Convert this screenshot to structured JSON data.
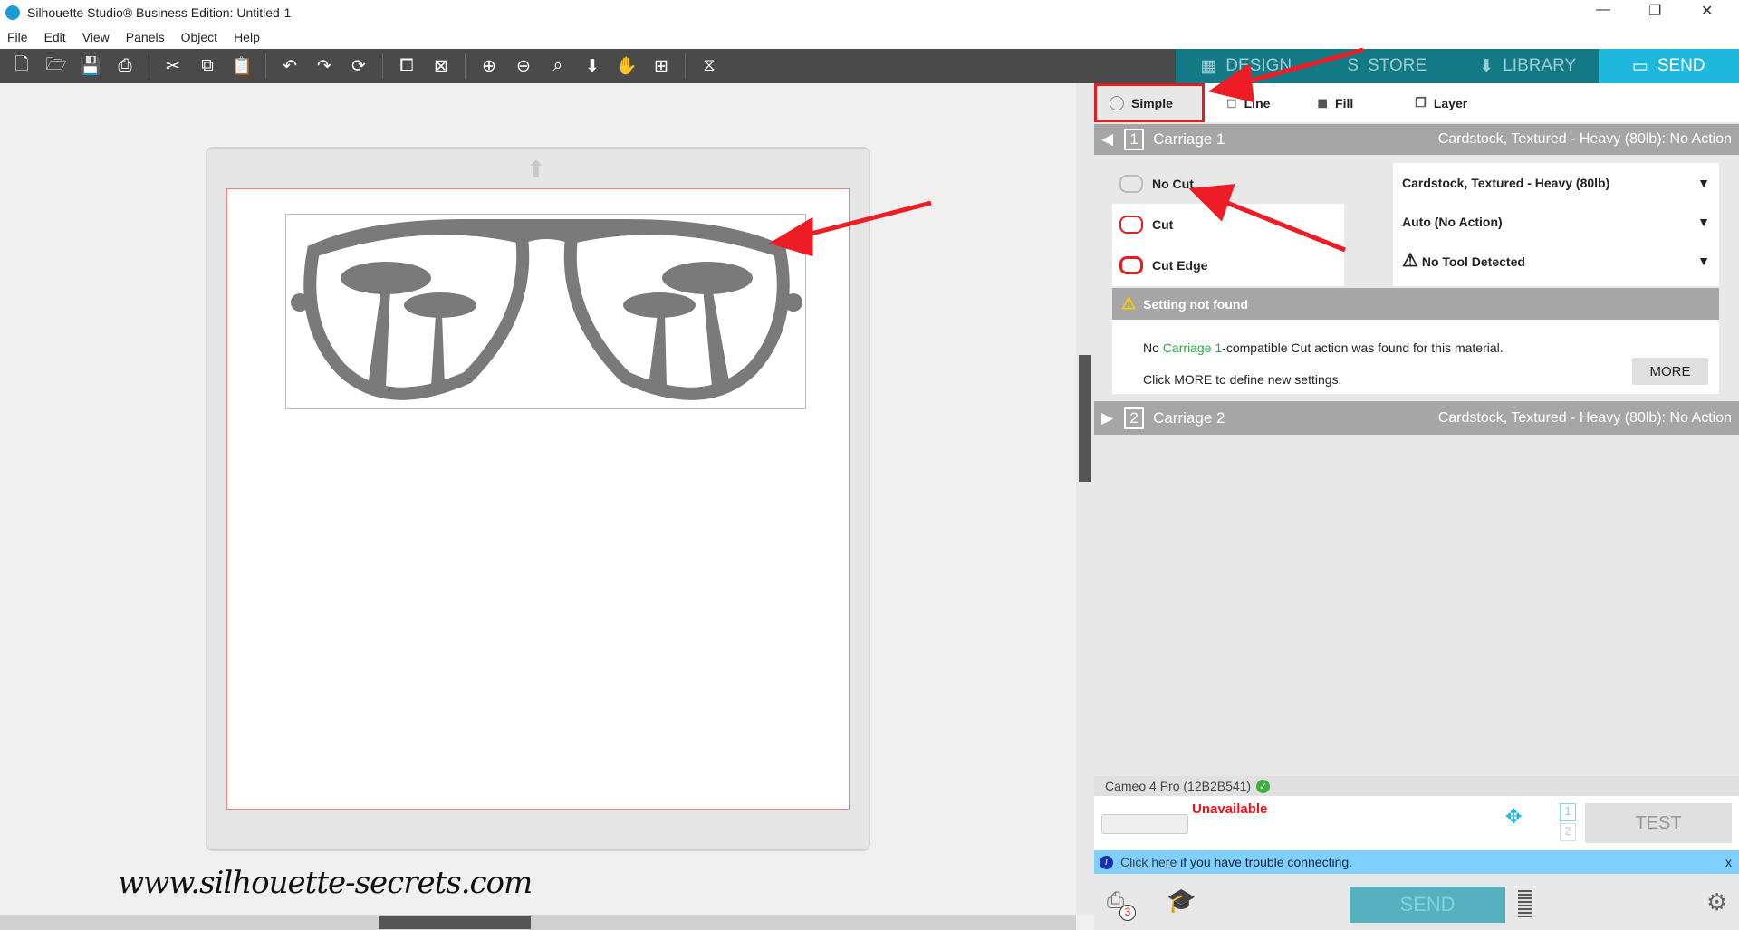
{
  "window": {
    "title": "Silhouette Studio® Business Edition: Untitled-1",
    "minimize": "—",
    "restore": "❐",
    "close": "✕"
  },
  "menu": [
    "File",
    "Edit",
    "View",
    "Panels",
    "Object",
    "Help"
  ],
  "toolbar": [
    "new",
    "open",
    "save",
    "print",
    "cut",
    "copy",
    "paste",
    "undo",
    "redo",
    "replicate",
    "group",
    "ungroup",
    "zoom-in",
    "zoom-out",
    "zoom-fit",
    "move-down",
    "pan",
    "add",
    "trace"
  ],
  "tabs": [
    {
      "label": "DESIGN",
      "icon": "▦"
    },
    {
      "label": "STORE",
      "icon": "S"
    },
    {
      "label": "LIBRARY",
      "icon": "⬇"
    },
    {
      "label": "SEND",
      "icon": "▭"
    }
  ],
  "options": {
    "simple": "Simple",
    "line": "Line",
    "fill": "Fill",
    "layer": "Layer"
  },
  "carriage1": {
    "num": "1",
    "label": "Carriage 1",
    "summary": "Cardstock, Textured - Heavy (80lb): No Action"
  },
  "actions": [
    "No Cut",
    "Cut",
    "Cut Edge"
  ],
  "settings": {
    "material": "Cardstock, Textured - Heavy (80lb)",
    "action": "Auto (No Action)",
    "tool": "No Tool Detected"
  },
  "warning": {
    "title": "Setting not found",
    "line1_pre": "No ",
    "line1_link": "Carriage 1",
    "line1_post": "-compatible Cut action was found for this material.",
    "line2": "Click MORE to define new settings.",
    "more": "MORE"
  },
  "carriage2": {
    "num": "2",
    "label": "Carriage 2",
    "summary": "Cardstock, Textured - Heavy (80lb): No Action"
  },
  "device": {
    "name": "Cameo 4 Pro (12B2B541)",
    "status": "Unavailable",
    "test": "TEST",
    "slot1": "1",
    "slot2": "2"
  },
  "info": {
    "link": "Click here",
    "text": " if you have trouble connecting.",
    "close": "x"
  },
  "bottom": {
    "send": "SEND",
    "badge": "3"
  },
  "watermark": "www.silhouette-secrets.com",
  "colors": {
    "accent": "#1fb8dd",
    "tabbar": "#137a85",
    "warning": "#e02020"
  }
}
